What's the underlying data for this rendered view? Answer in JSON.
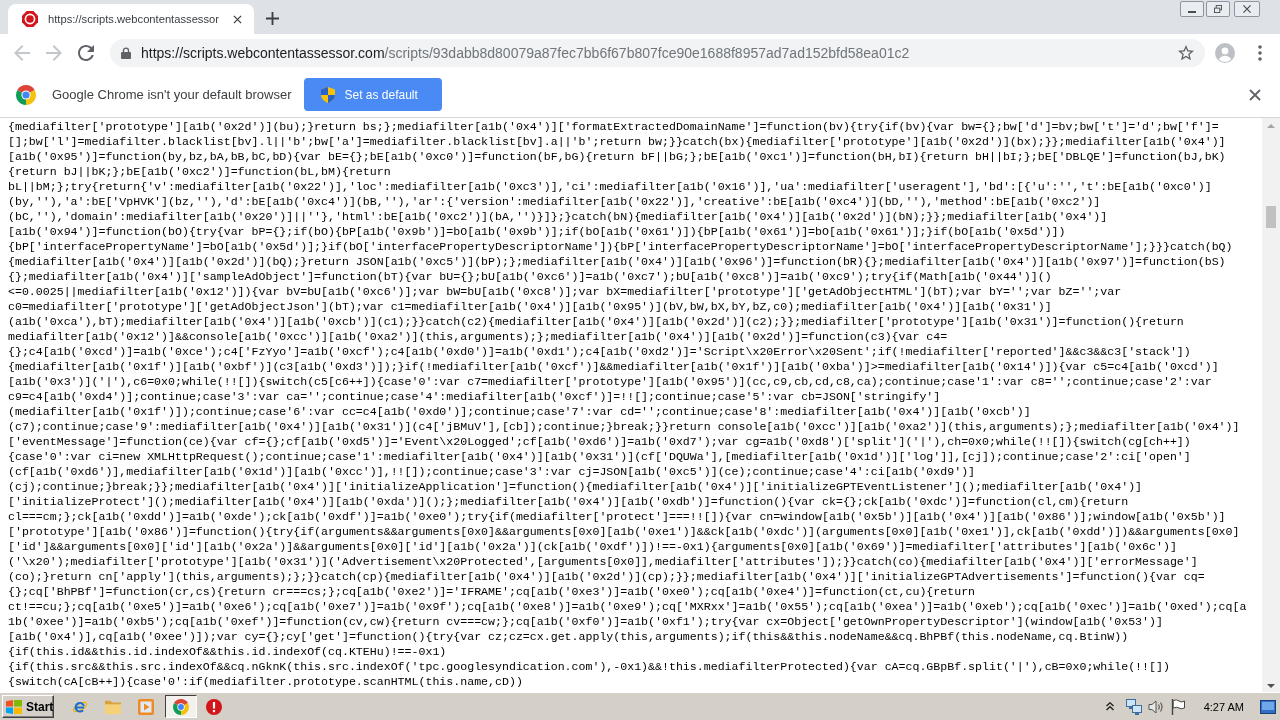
{
  "tabs": [
    {
      "title": "https://scripts.webcontentassessor",
      "selected": true
    }
  ],
  "toolbar": {
    "back": {
      "disabled": true
    },
    "forward": {
      "disabled": true
    },
    "address": {
      "host": "https://scripts.webcontentassessor.com",
      "path": "/scripts/93dabb8d80079a87fec7bb6f67b807fce90e1688f8957ad7ad152bfd58ea01c2"
    }
  },
  "infobar": {
    "message": "Google Chrome isn't your default browser",
    "button": "Set as default"
  },
  "code_lines": [
    "{mediafilter['prototype'][a1b('0x2d')](bu);}return bs;};mediafilter[a1b('0x4')]['formatExtractedDomainName']=function(bv){try{if(bv){var bw={};bw['d']=bv;bw['t']='d';bw['f']=",
    "[];bw['l']=mediafilter.blacklist[bv].l||'b';bw['a']=mediafilter.blacklist[bv].a||'b';return bw;}}catch(bx){mediafilter['prototype'][a1b('0x2d')](bx);}};mediafilter[a1b('0x4')]",
    "[a1b('0x95')]=function(by,bz,bA,bB,bC,bD){var bE={};bE[a1b('0xc0')]=function(bF,bG){return bF||bG;};bE[a1b('0xc1')]=function(bH,bI){return bH||bI;};bE['DBLQE']=function(bJ,bK)",
    "{return bJ||bK;};bE[a1b('0xc2')]=function(bL,bM){return",
    "bL||bM;};try{return{'v':mediafilter[a1b('0x22')],'loc':mediafilter[a1b('0xc3')],'ci':mediafilter[a1b('0x16')],'ua':mediafilter['useragent'],'bd':[{'u':'','t':bE[a1b('0xc0')]",
    "(by,''),'a':bE['VpHVK'](bz,''),'d':bE[a1b('0xc4')](bB,''),'ar':{'version':mediafilter[a1b('0x22')],'creative':bE[a1b('0xc4')](bD,''),'method':bE[a1b('0xc2')]",
    "(bC,''),'domain':mediafilter[a1b('0x20')]||''},'html':bE[a1b('0xc2')](bA,'')}]};}catch(bN){mediafilter[a1b('0x4')][a1b('0x2d')](bN);}};mediafilter[a1b('0x4')]",
    "[a1b('0x94')]=function(bO){try{var bP={};if(bO){bP[a1b('0x9b')]=bO[a1b('0x9b')];if(bO[a1b('0x61')]){bP[a1b('0x61')]=bO[a1b('0x61')];}if(bO[a1b('0x5d')])",
    "{bP['interfacePropertyName']=bO[a1b('0x5d')];}if(bO['interfacePropertyDescriptorName']){bP['interfacePropertyDescriptorName']=bO['interfacePropertyDescriptorName'];}}}catch(bQ)",
    "{mediafilter[a1b('0x4')][a1b('0x2d')](bQ);}return JSON[a1b('0xc5')](bP);};mediafilter[a1b('0x4')][a1b('0x96')]=function(bR){};mediafilter[a1b('0x4')][a1b('0x97')]=function(bS)",
    "{};mediafilter[a1b('0x4')]['sampleAdObject']=function(bT){var bU={};bU[a1b('0xc6')]=a1b('0xc7');bU[a1b('0xc8')]=a1b('0xc9');try{if(Math[a1b('0x44')]()",
    "<=0.0025||mediafilter[a1b('0x12')]){var bV=bU[a1b('0xc6')];var bW=bU[a1b('0xc8')];var bX=mediafilter['prototype']['getAdObjectHTML'](bT);var bY='';var bZ='';var",
    "c0=mediafilter['prototype']['getAdObjectJson'](bT);var c1=mediafilter[a1b('0x4')][a1b('0x95')](bV,bW,bX,bY,bZ,c0);mediafilter[a1b('0x4')][a1b('0x31')]",
    "(a1b('0xca'),bT);mediafilter[a1b('0x4')][a1b('0xcb')](c1);}}catch(c2){mediafilter[a1b('0x4')][a1b('0x2d')](c2);}};mediafilter['prototype'][a1b('0x31')]=function(){return",
    "mediafilter[a1b('0x12')]&&console[a1b('0xcc')][a1b('0xa2')](this,arguments);};mediafilter[a1b('0x4')][a1b('0x2d')]=function(c3){var c4=",
    "{};c4[a1b('0xcd')]=a1b('0xce');c4['FzYyo']=a1b('0xcf');c4[a1b('0xd0')]=a1b('0xd1');c4[a1b('0xd2')]='Script\\x20Error\\x20Sent';if(!mediafilter['reported']&&c3&&c3['stack'])",
    "{mediafilter[a1b('0x1f')][a1b('0xbf')](c3[a1b('0xd3')]);}if(!mediafilter[a1b('0xcf')]&&mediafilter[a1b('0x1f')][a1b('0xba')]>=mediafilter[a1b('0x14')]){var c5=c4[a1b('0xcd')]",
    "[a1b('0x3')]('|'),c6=0x0;while(!![]){switch(c5[c6++]){case'0':var c7=mediafilter['prototype'][a1b('0x95')](cc,c9,cb,cd,c8,ca);continue;case'1':var c8='';continue;case'2':var",
    "c9=c4[a1b('0xd4')];continue;case'3':var ca='';continue;case'4':mediafilter[a1b('0xcf')]=!![];continue;case'5':var cb=JSON['stringify']",
    "(mediafilter[a1b('0x1f')]);continue;case'6':var cc=c4[a1b('0xd0')];continue;case'7':var cd='';continue;case'8':mediafilter[a1b('0x4')][a1b('0xcb')]",
    "(c7);continue;case'9':mediafilter[a1b('0x4')][a1b('0x31')](c4['jBMuV'],[cb]);continue;}break;}}return console[a1b('0xcc')][a1b('0xa2')](this,arguments);};mediafilter[a1b('0x4')]",
    "['eventMessage']=function(ce){var cf={};cf[a1b('0xd5')]='Event\\x20Logged';cf[a1b('0xd6')]=a1b('0xd7');var cg=a1b('0xd8')['split']('|'),ch=0x0;while(!![]){switch(cg[ch++])",
    "{case'0':var ci=new XMLHttpRequest();continue;case'1':mediafilter[a1b('0x4')][a1b('0x31')](cf['DQUWa'],[mediafilter[a1b('0x1d')]['log']],[cj]);continue;case'2':ci['open']",
    "(cf[a1b('0xd6')],mediafilter[a1b('0x1d')][a1b('0xcc')],!![]);continue;case'3':var cj=JSON[a1b('0xc5')](ce);continue;case'4':ci[a1b('0xd9')]",
    "(cj);continue;}break;}};mediafilter[a1b('0x4')]['initializeApplication']=function(){mediafilter[a1b('0x4')]['initializeGPTEventListener']();mediafilter[a1b('0x4')]",
    "['initializeProtect']();mediafilter[a1b('0x4')][a1b('0xda')]();};mediafilter[a1b('0x4')][a1b('0xdb')]=function(){var ck={};ck[a1b('0xdc')]=function(cl,cm){return",
    "cl===cm;};ck[a1b('0xdd')]=a1b('0xde');ck[a1b('0xdf')]=a1b('0xe0');try{if(mediafilter['protect']===!![]){var cn=window[a1b('0x5b')][a1b('0x4')][a1b('0x86')];window[a1b('0x5b')]",
    "['prototype'][a1b('0x86')]=function(){try{if(arguments&&arguments[0x0]&&arguments[0x0][a1b('0xe1')]&&ck[a1b('0xdc')](arguments[0x0][a1b('0xe1')],ck[a1b('0xdd')])&&arguments[0x0]",
    "['id']&&arguments[0x0]['id'][a1b('0x2a')]&&arguments[0x0]['id'][a1b('0x2a')](ck[a1b('0xdf')])!==-0x1){arguments[0x0][a1b('0x69')]=mediafilter['attributes'][a1b('0x6c')]",
    "('\\x20');mediafilter['prototype'][a1b('0x31')]('Advertisement\\x20Protected',[arguments[0x0]],mediafilter['attributes']);}}catch(co){mediafilter[a1b('0x4')]['errorMessage']",
    "(co);}return cn['apply'](this,arguments);};}}catch(cp){mediafilter[a1b('0x4')][a1b('0x2d')](cp);}};mediafilter[a1b('0x4')]['initializeGPTAdvertisements']=function(){var cq=",
    "{};cq['BhPBf']=function(cr,cs){return cr===cs;};cq[a1b('0xe2')]='IFRAME';cq[a1b('0xe3')]=a1b('0xe0');cq[a1b('0xe4')]=function(ct,cu){return",
    "ct!==cu;};cq[a1b('0xe5')]=a1b('0xe6');cq[a1b('0xe7')]=a1b('0x9f');cq[a1b('0xe8')]=a1b('0xe9');cq['MXRxx']=a1b('0x55');cq[a1b('0xea')]=a1b('0xeb');cq[a1b('0xec')]=a1b('0xed');cq[a",
    "1b('0xee')]=a1b('0xb5');cq[a1b('0xef')]=function(cv,cw){return cv===cw;};cq[a1b('0xf0')]=a1b('0xf1');try{var cx=Object['getOwnPropertyDescriptor'](window[a1b('0x53')]",
    "[a1b('0x4')],cq[a1b('0xee')]);var cy={};cy['get']=function(){try{var cz;cz=cx.get.apply(this,arguments);if(this&&this.nodeName&&cq.BhPBf(this.nodeName,cq.BtinW))",
    "{if(this.id&&this.id.indexOf&&this.id.indexOf(cq.KTEHu)!==-0x1)",
    "{if(this.src&&this.src.indexOf&&cq.nGknK(this.src.indexOf('tpc.googlesyndication.com'),-0x1)&&!this.mediafilterProtected){var cA=cq.GBpBf.split('|'),cB=0x0;while(!![])",
    "{switch(cA[cB++]){case'0':if(mediafilter.prototype.scanHTML(this.name,cD))"
  ],
  "taskbar": {
    "start": "Start",
    "windows": [
      {
        "selected": true
      },
      {
        "selected": false
      }
    ],
    "clock": "4:27 AM"
  }
}
